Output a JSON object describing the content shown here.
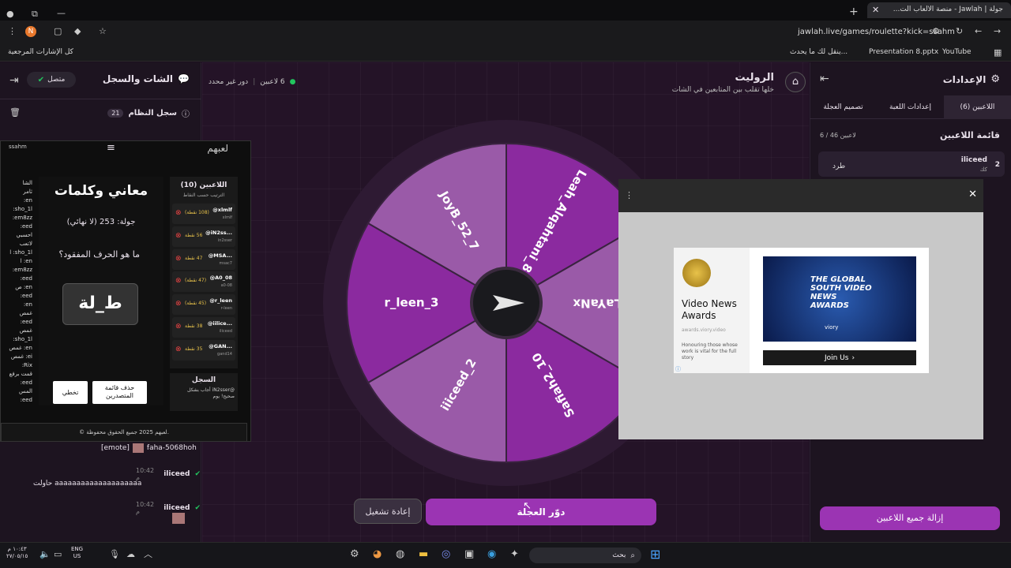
{
  "browser": {
    "tab_title": "جولة | Jawlah - منصة الألعاب الت...",
    "url": "jawlah.live/games/roulette?kick=ssahm",
    "bookmarks": [
      "YouTube",
      "Presentation 8.pptx",
      "ينقل لك ما يحدث...",
      "كل الإشارات المرجعية"
    ],
    "profile_initial": "N"
  },
  "chat": {
    "title": "الشات والسجل",
    "status": "متصل",
    "log_title": "سجل النظام",
    "log_count": "21",
    "messages": [
      {
        "user": "faha-5068hoh",
        "text": "[emote]",
        "time": ""
      },
      {
        "user": "iliceed",
        "time": "10:42 م",
        "text": "حاولت aaaaaaaaaaaaaaaaaaaa"
      },
      {
        "user": "iliceed",
        "time": "10:42 م",
        "text": ""
      }
    ]
  },
  "roulette": {
    "title": "الروليت",
    "subtitle": "خلها تقلب بين المتابعين في الشات",
    "players_count": "6 لاعبين",
    "round": "دور غير محدد",
    "segments": [
      "Leah_Alqahtani_8",
      "xLaYaNx",
      "Safiah2_10",
      "iiiceed_2",
      "r_leen_3",
      "JoyB_52_7"
    ],
    "spin_label": "دوّر العجلة",
    "reset_label": "إعادة تشغيل"
  },
  "settings": {
    "title": "الإعدادات",
    "tabs": [
      "اللاعبين (6)",
      "إعدادات اللعبة",
      "تصميم العجلة"
    ],
    "list_title": "قائمة اللاعبين",
    "list_count": "6 / 46 لاعبين",
    "player": {
      "rank": "2",
      "name": "iliceed",
      "sub": "كك",
      "action": "طرد"
    },
    "remove_all": "إزالة جميع اللاعبين"
  },
  "game": {
    "brand": "لعبهم",
    "user": "ssahm",
    "title": "معاني وكلمات",
    "round": "جولة: 253 (لا نهائي)",
    "question": "ما هو الحرف المفقود؟",
    "word": "ط_لة",
    "skip": "تخطي",
    "clear": "حذف قائمة المتصدرين",
    "players_title": "اللاعبين (10)",
    "players_sub": "الترتيب حسب النقاط",
    "players": [
      {
        "name": "@xlmlf",
        "sub": "xlmlf",
        "pts": "(108 نقطة)"
      },
      {
        "name": "@iN2ss...",
        "sub": "in2sser",
        "pts": "56 نقطة"
      },
      {
        "name": "@MSA...",
        "sub": "msac7",
        "pts": "47 نقطة"
      },
      {
        "name": "@A0_08",
        "sub": "a0-08",
        "pts": "(47 نقطة)"
      },
      {
        "name": "@r_leen",
        "sub": "r-leen",
        "pts": "(45 نقطة)"
      },
      {
        "name": "@iilice...",
        "sub": "iliceed",
        "pts": "38 نقطة"
      },
      {
        "name": "@GAN...",
        "sub": "gand14",
        "pts": "35 نقطة"
      }
    ],
    "log_title": "السجل",
    "log_text": "@iN2sser أجاب بشكل صحيح! يوم",
    "footer": "© لعبهم 2025 جميع الحقوق محفوظة.",
    "side_chat": [
      "الشا",
      "ثامر",
      "en:",
      "sho_1l:",
      "em8zz:",
      "eed:",
      "احسبي",
      "لاتعب",
      "sho_1l: ا",
      "en: ا",
      "em8zz:",
      "eed:",
      "en: ص",
      "eed:",
      "en:",
      "غمص",
      "eed:",
      "غمص",
      "sho_1l:",
      "en: غمص",
      "ei: غمص",
      "Rix:",
      "قمت برفع",
      "eed:",
      "المس",
      "eed:"
    ]
  },
  "ad": {
    "title": "Video News Awards",
    "source": "awards.viory.video",
    "desc": "Honouring those whose work is vital for the full story",
    "image_text": "THE GLOBAL SOUTH VIDEO NEWS AWARDS",
    "image_brand": "viory",
    "cta": "Join Us"
  },
  "taskbar": {
    "search": "بحث",
    "lang": "ENG",
    "lang2": "US",
    "time": "١٠:٤٣ م",
    "date": "٢٧/٠٥/١٥"
  },
  "colors": {
    "accent": "#9b34b3",
    "segment_light": "#9a5aa8",
    "segment_dark": "#8b2a9f"
  }
}
